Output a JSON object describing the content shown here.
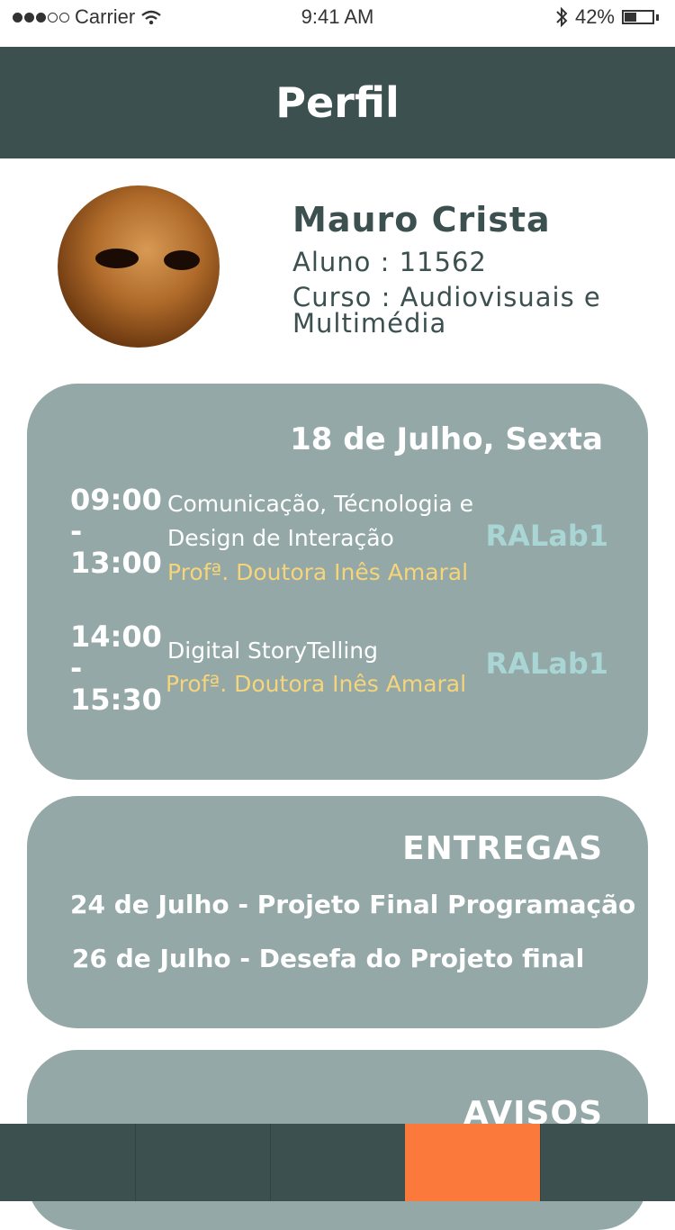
{
  "status_bar": {
    "carrier": "Carrier",
    "time": "9:41 AM",
    "battery": "42%",
    "battery_level": 0.42,
    "icons": [
      "signal-dots-icon",
      "wifi-icon",
      "bluetooth-icon",
      "battery-icon"
    ]
  },
  "header": {
    "title": "Perfil"
  },
  "profile": {
    "name": "Mauro Crista",
    "student": "Aluno : 11562",
    "course_line1": "Curso : Audiovisuais e",
    "course_line2": "Multimédia"
  },
  "schedule": {
    "date": "18 de Julho, Sexta",
    "slots": [
      {
        "start": "09:00",
        "sep": "-",
        "end": "13:00",
        "subject_line1": "Comunicação, Técnologia e",
        "subject_line2": "Design de Interação",
        "teacher": "Profª. Doutora Inês Amaral",
        "room": "RALab1"
      },
      {
        "start": "14:00",
        "sep": "-",
        "end": "15:30",
        "subject_line1": "Digital StoryTelling",
        "teacher": "Profª. Doutora Inês Amaral",
        "room": "RALab1"
      }
    ]
  },
  "entregas": {
    "title": "ENTREGAS",
    "items": [
      "24 de Julho - Projeto Final Programação",
      "26 de Julho - Desefa do Projeto final"
    ]
  },
  "avisos": {
    "title": "AVISOS"
  },
  "tab_bar": {
    "active_index": 3,
    "tab_count": 5
  },
  "colors": {
    "header": "#3c5050",
    "card": "#93a8a7",
    "teacher": "#f6d57a",
    "room": "#a9d6d4",
    "active_tab": "#fb7a3b"
  }
}
